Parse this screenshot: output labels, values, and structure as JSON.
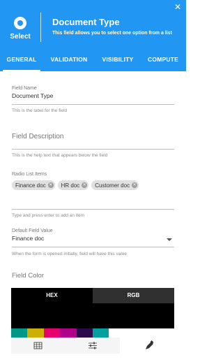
{
  "header": {
    "close_glyph": "✕",
    "type_icon": "radio-icon",
    "type_label": "Select",
    "title": "Document Type",
    "subtitle": "This field allows you to select one option from a list",
    "bg_color": "#2196f3"
  },
  "tabs": [
    {
      "label": "GENERAL",
      "active": true
    },
    {
      "label": "VALIDATION",
      "active": false
    },
    {
      "label": "VISIBILITY",
      "active": false
    },
    {
      "label": "COMPUTE",
      "active": false
    }
  ],
  "field_name": {
    "label": "Field Name",
    "value": "Document Type",
    "help": "This is the label for the field"
  },
  "field_description": {
    "placeholder": "Field Description",
    "help": "This is the help text that appears below the field"
  },
  "radio_list": {
    "label": "Radio List Items",
    "items": [
      "Finance doc",
      "HR doc",
      "Customer doc"
    ],
    "remove_glyph": "✕",
    "help": "Type and press enter to add an item"
  },
  "default_value": {
    "label": "Default Field Value",
    "value": "Finance doc",
    "help": "When the form is opened initially, field will have this value"
  },
  "field_color": {
    "label": "Field Color",
    "tabs": [
      "HEX",
      "RGB"
    ],
    "swatches": [
      "#009688",
      "#ccb000",
      "#e6006e",
      "#b0008a",
      "#2a0a4a",
      "#00a0a0"
    ],
    "toolbar_icons": [
      "palette-grid-icon",
      "sliders-icon",
      "eyedropper-icon"
    ]
  }
}
